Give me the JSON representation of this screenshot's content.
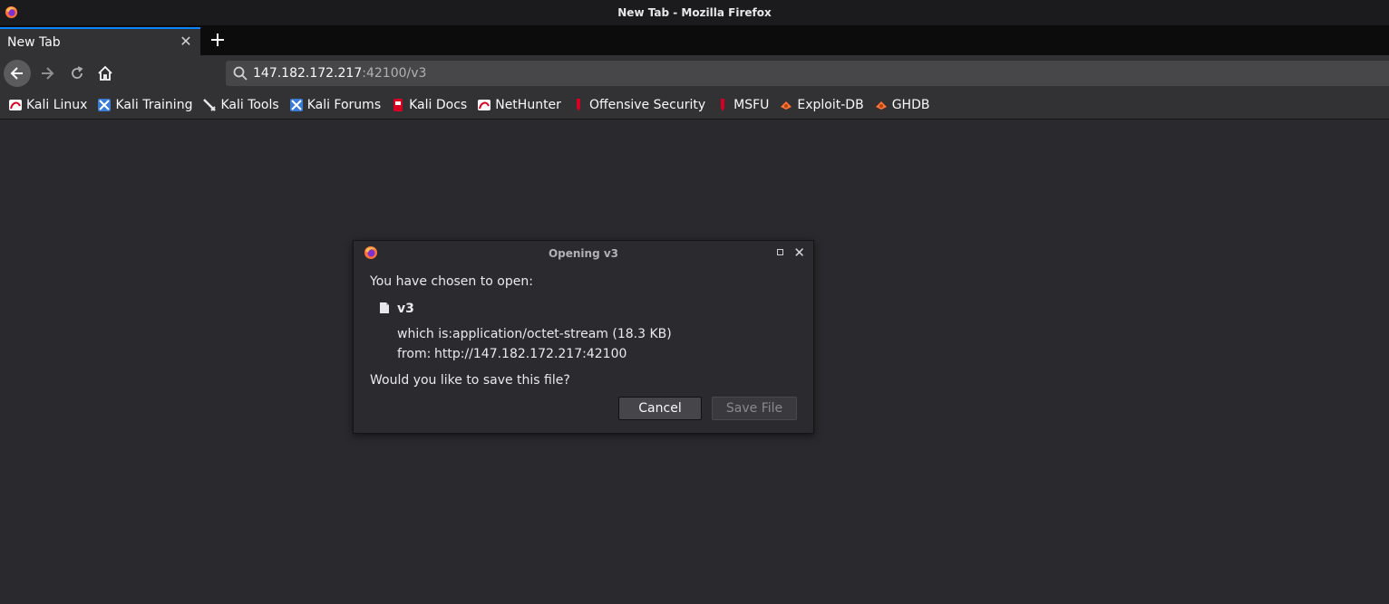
{
  "window": {
    "title": "New Tab - Mozilla Firefox"
  },
  "tabs": [
    {
      "label": "New Tab",
      "active": true
    }
  ],
  "navbar": {
    "url_host": "147.182.172.217",
    "url_rest": ":42100/v3"
  },
  "bookmarks": [
    {
      "label": "Kali Linux",
      "icon": "kali-dragon-icon"
    },
    {
      "label": "Kali Training",
      "icon": "kali-training-icon"
    },
    {
      "label": "Kali Tools",
      "icon": "kali-tools-icon"
    },
    {
      "label": "Kali Forums",
      "icon": "kali-forums-icon"
    },
    {
      "label": "Kali Docs",
      "icon": "kali-docs-icon"
    },
    {
      "label": "NetHunter",
      "icon": "nethunter-icon"
    },
    {
      "label": "Offensive Security",
      "icon": "offsec-icon"
    },
    {
      "label": "MSFU",
      "icon": "msfu-icon"
    },
    {
      "label": "Exploit-DB",
      "icon": "exploitdb-icon"
    },
    {
      "label": "GHDB",
      "icon": "ghdb-icon"
    }
  ],
  "dialog": {
    "title": "Opening v3",
    "intro": "You have chosen to open:",
    "filename": "v3",
    "which_is_label": "which is:",
    "which_is_value": "application/octet-stream (18.3 KB)",
    "from_label": "from:",
    "from_value": "http://147.182.172.217:42100",
    "question": "Would you like to save this file?",
    "cancel_label": "Cancel",
    "save_label": "Save File"
  },
  "colors": {
    "accent": "#0a84ff",
    "toolbar": "#323234",
    "background": "#2a2a2e"
  }
}
